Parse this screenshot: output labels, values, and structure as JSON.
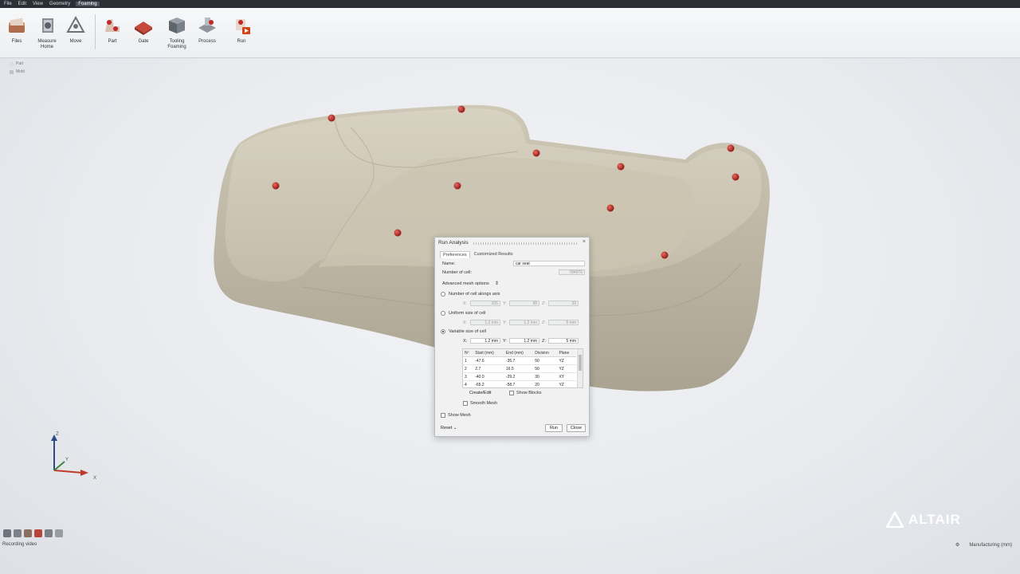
{
  "menubar": {
    "items": [
      "File",
      "Edit",
      "View",
      "Geometry",
      "Foaming"
    ],
    "active": "Foaming"
  },
  "ribbon": {
    "files": "Files",
    "measure_home": "Measure Home",
    "move": "Move",
    "part": "Part",
    "gate": "Gate",
    "tooling_foaming": "Tooling Foaming",
    "process": "Process",
    "run": "Run"
  },
  "tree": {
    "items": [
      "Part",
      "Mold"
    ]
  },
  "dialog": {
    "title": "Run Analysis",
    "tabs": [
      "Preferences",
      "Customized Results"
    ],
    "name_label": "Name:",
    "name_value": "car seat",
    "num_cells_label": "Number of cell:",
    "num_cells_value": "784976",
    "advanced_label": "Advanced mesh options",
    "opt_cells_axis": "Number of cell alongs axis",
    "axis_x": "205",
    "axis_y": "98",
    "axis_z": "39",
    "opt_uniform": "Uniform size of cell",
    "uni_x": "1.2 mm",
    "uni_y": "1.2 mm",
    "uni_z": "5 mm",
    "opt_variable": "Variable size of cell",
    "var_x": "1.2 mm",
    "var_y": "1.2 mm",
    "var_z": "5 mm",
    "x_label": "X:",
    "y_label": "Y:",
    "z_label": "Z:",
    "table": {
      "headers": [
        "Nº",
        "Start (mm)",
        "End (mm)",
        "Division",
        "Plane"
      ],
      "rows": [
        [
          "1",
          "-47.6",
          "-35.7",
          "50",
          "YZ"
        ],
        [
          "2",
          "2.7",
          "16.5",
          "50",
          "YZ"
        ],
        [
          "3",
          "-40.0",
          "-29.2",
          "30",
          "XY"
        ],
        [
          "4",
          "-65.2",
          "-58.7",
          "20",
          "YZ"
        ]
      ]
    },
    "create_edit": "Create/Edit",
    "show_blocks": "Show Blocks",
    "smooth_mesh": "Smooth Mesh",
    "show_mesh": "Show Mesh",
    "reset": "Reset",
    "run": "Run",
    "close": "Close"
  },
  "axes": {
    "z": "Z",
    "y": "Y",
    "x": "X"
  },
  "status": {
    "text": "Recording video",
    "units": "Manufacturing (mm)"
  },
  "brand": {
    "name": "ALTAIR"
  },
  "colors": {
    "part": "#cfc8b7",
    "marker": "#b5201d",
    "menubar": "#2b2f36",
    "ribbon": "#eceef0"
  },
  "icons": [
    "files-icon",
    "measure-home-icon",
    "move-icon",
    "part-icon",
    "gate-icon",
    "tooling-foaming-icon",
    "process-icon",
    "run-icon"
  ]
}
